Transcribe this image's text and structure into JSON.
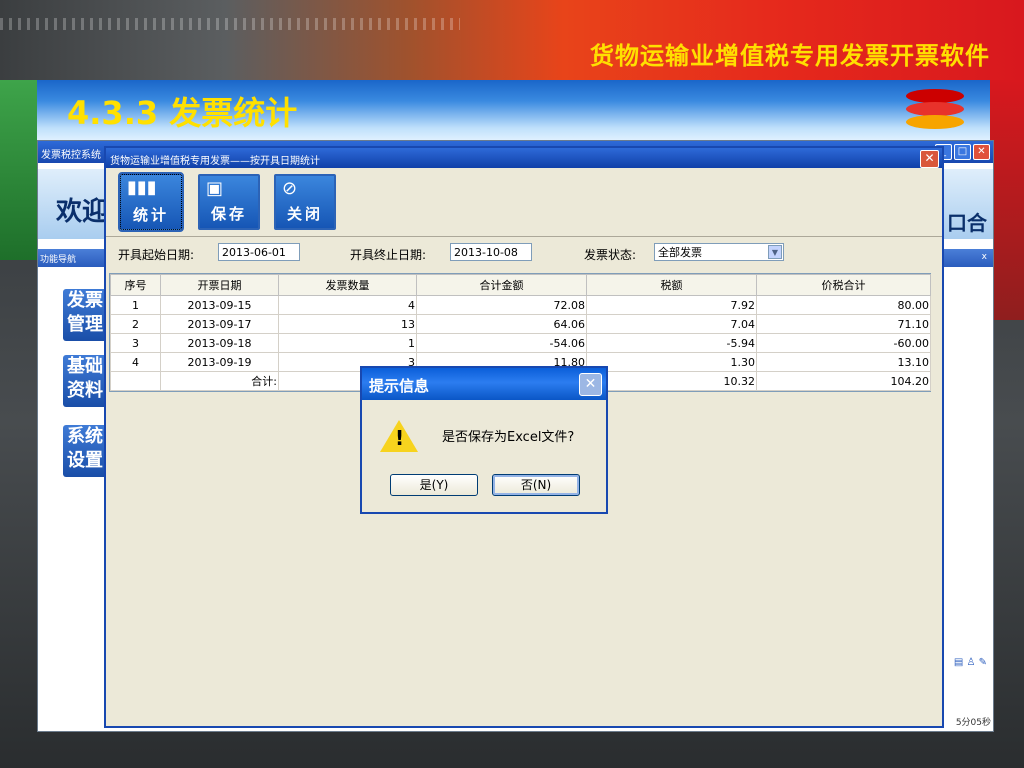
{
  "slide": {
    "top_title": "货物运输业增值税专用发票开票软件",
    "section_title": "4.3.3 发票统计"
  },
  "app": {
    "title": "发票税控系统",
    "welcome": "欢迎",
    "exit": "口合",
    "nav_header": "功能导航",
    "nav_close": "x",
    "nav_items": [
      {
        "label": "发票管理"
      },
      {
        "label": "基础资料"
      },
      {
        "label": "系统设置"
      }
    ],
    "status_time": "5分05秒"
  },
  "stat_window": {
    "title": "货物运输业增值税专用发票——按开具日期统计",
    "toolbar": [
      {
        "label": "统计",
        "icon": "bar-chart-icon"
      },
      {
        "label": "保存",
        "icon": "floppy-save-icon"
      },
      {
        "label": "关闭",
        "icon": "no-entry-icon"
      }
    ],
    "filters": {
      "start_label": "开具起始日期:",
      "start_value": "2013-06-01",
      "end_label": "开具终止日期:",
      "end_value": "2013-10-08",
      "status_label": "发票状态:",
      "status_value": "全部发票"
    },
    "table": {
      "columns": [
        "序号",
        "开票日期",
        "发票数量",
        "合计金额",
        "税额",
        "价税合计"
      ],
      "rows": [
        [
          "1",
          "2013-09-15",
          "4",
          "72.08",
          "7.92",
          "80.00"
        ],
        [
          "2",
          "2013-09-17",
          "13",
          "64.06",
          "7.04",
          "71.10"
        ],
        [
          "3",
          "2013-09-18",
          "1",
          "-54.06",
          "-5.94",
          "-60.00"
        ],
        [
          "4",
          "2013-09-19",
          "3",
          "11.80",
          "1.30",
          "13.10"
        ]
      ],
      "total_row": {
        "label": "合计:",
        "tax": "10.32",
        "total": "104.20"
      }
    }
  },
  "dialog": {
    "title": "提示信息",
    "message": "是否保存为Excel文件?",
    "yes": "是(Y)",
    "no": "否(N)"
  }
}
